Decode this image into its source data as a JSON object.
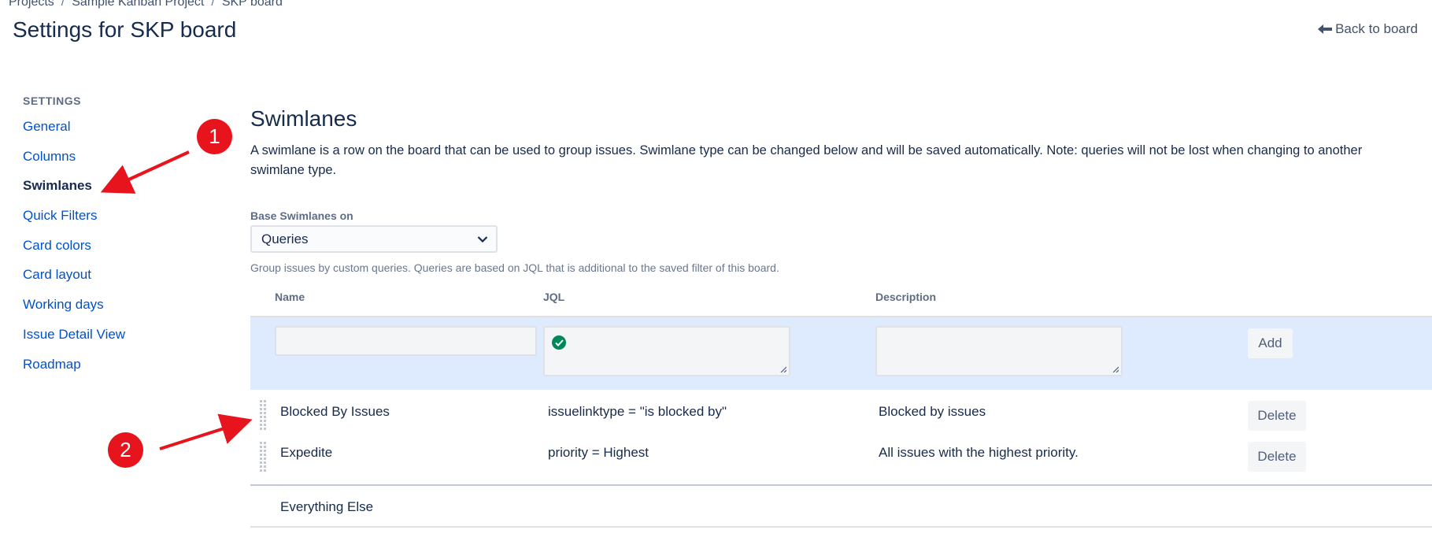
{
  "breadcrumb": [
    "Projects",
    "Sample Kanban Project",
    "SKP board"
  ],
  "page_title": "Settings for SKP board",
  "back_link": "Back to board",
  "sidebar": {
    "heading": "SETTINGS",
    "items": [
      {
        "label": "General",
        "active": false
      },
      {
        "label": "Columns",
        "active": false
      },
      {
        "label": "Swimlanes",
        "active": true
      },
      {
        "label": "Quick Filters",
        "active": false
      },
      {
        "label": "Card colors",
        "active": false
      },
      {
        "label": "Card layout",
        "active": false
      },
      {
        "label": "Working days",
        "active": false
      },
      {
        "label": "Issue Detail View",
        "active": false
      },
      {
        "label": "Roadmap",
        "active": false
      }
    ]
  },
  "main": {
    "title": "Swimlanes",
    "description": "A swimlane is a row on the board that can be used to group issues. Swimlane type can be changed below and will be saved automatically. Note: queries will not be lost when changing to another swimlane type.",
    "base_label": "Base Swimlanes on",
    "base_value": "Queries",
    "help_text": "Group issues by custom queries. Queries are based on JQL that is additional to the saved filter of this board."
  },
  "table": {
    "headers": {
      "name": "Name",
      "jql": "JQL",
      "description": "Description"
    },
    "add_button": "Add",
    "rows": [
      {
        "name": "Blocked By Issues",
        "jql": "issuelinktype = \"is blocked by\"",
        "description": "Blocked by issues",
        "action": "Delete"
      },
      {
        "name": "Expedite",
        "jql": "priority = Highest",
        "description": "All issues with the highest priority.",
        "action": "Delete"
      }
    ],
    "fallback_row": "Everything Else"
  },
  "annotations": [
    "1",
    "2"
  ],
  "colors": {
    "link": "#0052cc",
    "text": "#172b4d",
    "add_row_bg": "#deebff",
    "annotation": "#e8141d",
    "valid_check": "#00875a"
  }
}
